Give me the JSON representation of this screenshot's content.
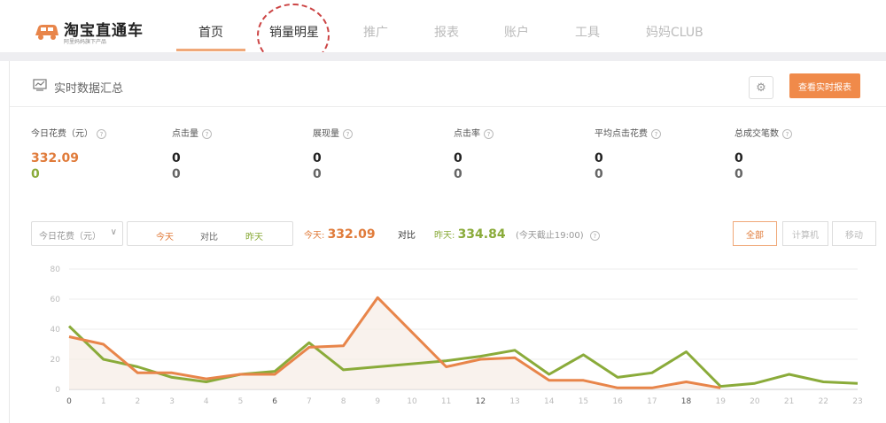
{
  "brand": {
    "name": "淘宝直通车",
    "tagline": "阿里妈妈旗下产品"
  },
  "nav": [
    {
      "label": "首页",
      "active": true
    },
    {
      "label": "销量明星",
      "active": false
    },
    {
      "label": "推广",
      "active": false
    },
    {
      "label": "报表",
      "active": false
    },
    {
      "label": "账户",
      "active": false
    },
    {
      "label": "工具",
      "active": false
    },
    {
      "label": "妈妈CLUB",
      "active": false
    }
  ],
  "panel": {
    "title": "实时数据汇总",
    "settings_icon": "gear-icon",
    "report_button": "查看实时报表"
  },
  "metrics": [
    {
      "label": "今日花费（元）",
      "today": "332.09",
      "yesterday": "0"
    },
    {
      "label": "点击量",
      "today": "0",
      "yesterday": "0"
    },
    {
      "label": "展现量",
      "today": "0",
      "yesterday": "0"
    },
    {
      "label": "点击率",
      "today": "0",
      "yesterday": "0"
    },
    {
      "label": "平均点击花费",
      "today": "0",
      "yesterday": "0"
    },
    {
      "label": "总成交笔数",
      "today": "0",
      "yesterday": "0"
    }
  ],
  "controls": {
    "metric_select": "今日花费（元）",
    "segments": [
      "今天",
      "对比",
      "昨天"
    ],
    "today_label": "今天:",
    "today_value": "332.09",
    "compare_word": "对比",
    "yesterday_label": "昨天:",
    "yesterday_value": "334.84",
    "note": "(今天截止19:00)",
    "devices": [
      "全部",
      "计算机",
      "移动"
    ]
  },
  "colors": {
    "today": "#e8854a",
    "yesterday": "#8aab3a",
    "accent": "#f08a4a"
  },
  "chart_data": {
    "type": "line",
    "x": [
      "0",
      "1",
      "2",
      "3",
      "4",
      "5",
      "6",
      "7",
      "8",
      "9",
      "10",
      "11",
      "12",
      "13",
      "14",
      "15",
      "16",
      "17",
      "18",
      "19",
      "20",
      "21",
      "22",
      "23"
    ],
    "ylim": [
      0,
      80
    ],
    "yticks": [
      "0",
      "20",
      "40",
      "60",
      "80"
    ],
    "series": [
      {
        "values": [
          35,
          30,
          11,
          11,
          7,
          10,
          10,
          28,
          29,
          61,
          38,
          15,
          20,
          21,
          6,
          6,
          1,
          1,
          5,
          1
        ]
      },
      {
        "values": [
          42,
          20,
          15,
          8,
          5,
          10,
          12,
          31,
          13,
          15,
          17,
          19,
          22,
          26,
          10,
          23,
          8,
          11,
          25,
          2,
          4,
          10,
          5,
          4
        ]
      }
    ]
  }
}
